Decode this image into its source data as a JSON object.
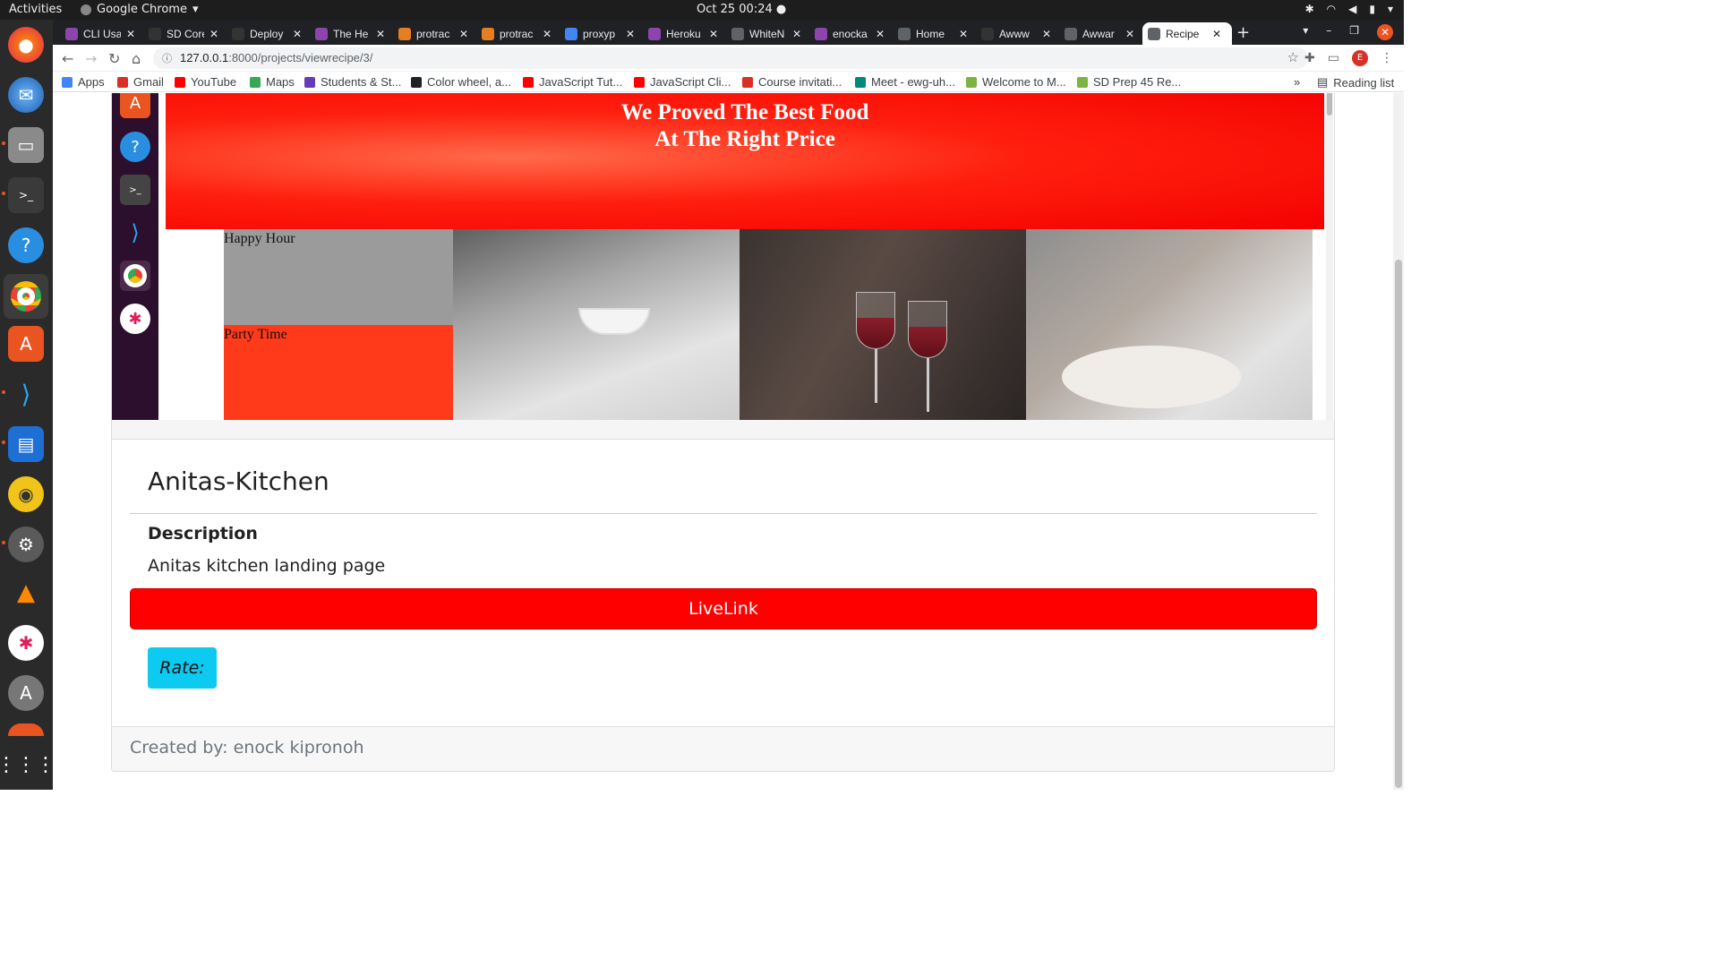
{
  "topbar": {
    "activities": "Activities",
    "app_name": "Google Chrome",
    "clock": "Oct 25  00:24"
  },
  "dock": {
    "items": [
      "firefox-icon",
      "thunderbird-icon",
      "files-icon",
      "terminal-icon",
      "help-icon",
      "chrome-icon",
      "software-icon",
      "vscode-icon",
      "writer-icon",
      "rhythmbox-icon",
      "settings-icon",
      "vlc-icon",
      "slack-icon",
      "updater-icon",
      "show-apps-icon"
    ]
  },
  "browser": {
    "tabs": [
      {
        "title": "CLI Usa",
        "color": "#8e44ad"
      },
      {
        "title": "SD Core",
        "color": "#333333"
      },
      {
        "title": "Deploy",
        "color": "#333333"
      },
      {
        "title": "The He",
        "color": "#8e44ad"
      },
      {
        "title": "protrac",
        "color": "#e67e22"
      },
      {
        "title": "protrac",
        "color": "#e67e22"
      },
      {
        "title": "proxyp",
        "color": "#4285f4"
      },
      {
        "title": "Heroku",
        "color": "#8e44ad"
      },
      {
        "title": "WhiteN",
        "color": "#5f6368"
      },
      {
        "title": "enocka",
        "color": "#8e44ad"
      },
      {
        "title": "Home",
        "color": "#5f6368"
      },
      {
        "title": "Awww",
        "color": "#333333"
      },
      {
        "title": "Awwar",
        "color": "#5f6368"
      },
      {
        "title": "Recipe",
        "color": "#5f6368",
        "active": true
      }
    ],
    "url_host": "127.0.0.1",
    "url_rest": ":8000/projects/viewrecipe/3/",
    "profile_initial": "E",
    "bookmarks": [
      {
        "label": "Apps",
        "color": "#4285f4"
      },
      {
        "label": "Gmail",
        "color": "#d93025"
      },
      {
        "label": "YouTube",
        "color": "#ff0000"
      },
      {
        "label": "Maps",
        "color": "#34a853"
      },
      {
        "label": "Students & St...",
        "color": "#673ab7"
      },
      {
        "label": "Color wheel, a...",
        "color": "#202124"
      },
      {
        "label": "JavaScript Tut...",
        "color": "#ff0000"
      },
      {
        "label": "JavaScript Cli...",
        "color": "#ff0000"
      },
      {
        "label": "Course invitati...",
        "color": "#d93025"
      },
      {
        "label": "Meet - ewg-uh...",
        "color": "#00897b"
      },
      {
        "label": "Welcome to M...",
        "color": "#7cb342"
      },
      {
        "label": "SD Prep 45 Re...",
        "color": "#7cb342"
      }
    ],
    "reading_list": "Reading list"
  },
  "preview": {
    "hero_line1": "We Proved The Best Food",
    "hero_line2": "At The Right Price",
    "tile1_label": "Happy Hour",
    "tile2_label": "Party Time"
  },
  "project": {
    "title": "Anitas-Kitchen",
    "description_heading": "Description",
    "description": "Anitas kitchen landing page",
    "livelink_label": "LiveLink",
    "rate_label": "Rate:",
    "footer": "Created by: enock kipronoh"
  }
}
